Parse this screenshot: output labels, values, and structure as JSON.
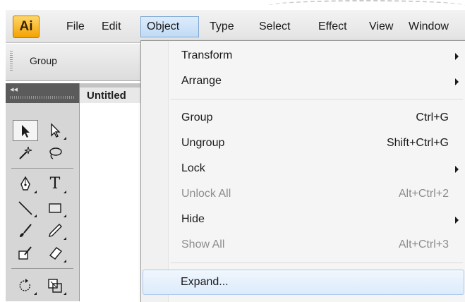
{
  "menubar": {
    "logo": "Ai",
    "items": [
      "File",
      "Edit",
      "Object",
      "Type",
      "Select",
      "Effect",
      "View",
      "Window"
    ],
    "active": "Object"
  },
  "control_bar": {
    "label": "Group"
  },
  "document": {
    "tab_title": "Untitled"
  },
  "tools": [
    {
      "name": "selection-tool-icon",
      "glyph": "➤"
    },
    {
      "name": "direct-selection-tool-icon",
      "glyph": "⬈"
    },
    {
      "name": "magic-wand-tool-icon",
      "glyph": "✳"
    },
    {
      "name": "lasso-tool-icon",
      "glyph": "☊"
    },
    {
      "name": "pen-tool-icon",
      "glyph": "✒"
    },
    {
      "name": "type-tool-icon",
      "glyph": "T"
    },
    {
      "name": "line-segment-tool-icon",
      "glyph": "╲"
    },
    {
      "name": "rectangle-tool-icon",
      "glyph": "▭"
    },
    {
      "name": "paintbrush-tool-icon",
      "glyph": "✎"
    },
    {
      "name": "pencil-tool-icon",
      "glyph": "✏"
    },
    {
      "name": "blob-brush-tool-icon",
      "glyph": "✍"
    },
    {
      "name": "eraser-tool-icon",
      "glyph": "▱"
    },
    {
      "name": "rotate-tool-icon",
      "glyph": "↻"
    },
    {
      "name": "scale-tool-icon",
      "glyph": "⧉"
    }
  ],
  "object_menu": {
    "items": [
      {
        "label": "Transform",
        "shortcut": "",
        "submenu": true,
        "disabled": false
      },
      {
        "label": "Arrange",
        "shortcut": "",
        "submenu": true,
        "disabled": false
      },
      {
        "label": "Group",
        "shortcut": "Ctrl+G",
        "submenu": false,
        "disabled": false
      },
      {
        "label": "Ungroup",
        "shortcut": "Shift+Ctrl+G",
        "submenu": false,
        "disabled": false
      },
      {
        "label": "Lock",
        "shortcut": "",
        "submenu": true,
        "disabled": false
      },
      {
        "label": "Unlock All",
        "shortcut": "Alt+Ctrl+2",
        "submenu": false,
        "disabled": true
      },
      {
        "label": "Hide",
        "shortcut": "",
        "submenu": true,
        "disabled": false
      },
      {
        "label": "Show All",
        "shortcut": "Alt+Ctrl+3",
        "submenu": false,
        "disabled": true
      },
      {
        "label": "Expand...",
        "shortcut": "",
        "submenu": false,
        "disabled": false,
        "highlighted": true
      }
    ]
  },
  "colors": {
    "logo_bg": "#f3a200",
    "menu_active": "#c1dbf5",
    "hover": "#dcebfb",
    "disabled_text": "#8d8d8d"
  }
}
